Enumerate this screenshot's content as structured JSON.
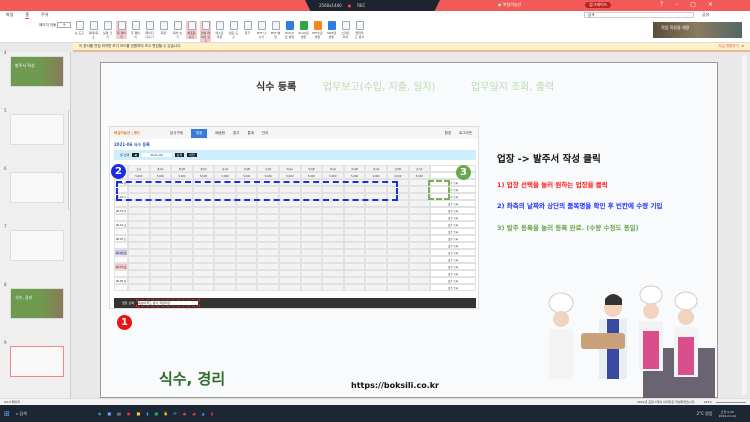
{
  "titlebar": {
    "recording": "REC",
    "screen": "2560x1440",
    "meeting": "미팅중입니다",
    "user": "복실이농산",
    "upgrade": "업그레이드",
    "window_controls": [
      "?",
      "–",
      "□",
      "×"
    ]
  },
  "menu_tabs": [
    "파일",
    "홈",
    "주석"
  ],
  "ribbon": {
    "page_label": "페이지 이동",
    "page_value": "9",
    "search_placeholder": "검색",
    "share": "공유",
    "tools": [
      [
        "손 도구",
        ""
      ],
      [
        "확대/축소",
        ""
      ],
      [
        "실제 크기",
        ""
      ],
      [
        "쪽 페이지",
        "sel"
      ],
      [
        "두 페이지",
        ""
      ],
      [
        "페이지 나누기",
        ""
      ],
      [
        "회전",
        ""
      ],
      [
        "목차 보기",
        ""
      ],
      [
        "발표용 보기",
        "sel"
      ],
      [
        "연속 페이지 보기",
        "sel"
      ],
      [
        "텍스트 작성",
        ""
      ],
      [
        "필요 도구",
        ""
      ],
      [
        "찾기",
        ""
      ],
      [
        "PDF 나누기",
        ""
      ],
      [
        "PDF 병합",
        ""
      ],
      [
        "DOCX로 변환",
        "b"
      ],
      [
        "XLSX로 변환",
        "g"
      ],
      [
        "PPTX로 변환",
        "o"
      ],
      [
        "HWP로 변환",
        "b"
      ],
      [
        "스마트 회의",
        ""
      ],
      [
        "클라우드 문서",
        ""
      ]
    ]
  },
  "ad": {
    "text": "직업 직원들 채용"
  },
  "notice": {
    "message": "이 문서를 편집 하려면 보기 모드를 전환하여 보고 편집할 수 있습니다.",
    "action": "지금 변환하기",
    "close": "×"
  },
  "thumbnails": [
    {
      "num": "4",
      "type": "green",
      "title": "발주서 작성"
    },
    {
      "num": "5",
      "type": "slide"
    },
    {
      "num": "6",
      "type": "slide"
    },
    {
      "num": "7",
      "type": "slide"
    },
    {
      "num": "8",
      "type": "green",
      "title": "식수, 경리"
    },
    {
      "num": "9",
      "type": "slide",
      "selected": true
    },
    {
      "num": "10",
      "type": "slide"
    }
  ],
  "slide": {
    "tabs": [
      {
        "label": "식수 등록",
        "color": "#1f5a1f"
      },
      {
        "label": "업무보고(수입, 지출, 일지)",
        "color": "#b9dbb0"
      },
      {
        "label": "업무일지 조회, 출력",
        "color": "#b9dbb0"
      }
    ],
    "app": {
      "logo": "복실이농산 | 푸드",
      "nav": [
        "본사구매",
        "업장",
        "배송현",
        "창고",
        "통계",
        "관리"
      ],
      "active_nav": 1,
      "right_nav": [
        "환경",
        "로그아웃"
      ],
      "page_title": "2021-06 식수 등록",
      "search_label": "월 선택",
      "search_value": "2021-06",
      "search_btn": "검색",
      "prev_btn": "이전",
      "columns": [
        "",
        "조식",
        "중식A",
        "중식B",
        "중식C",
        "석식A",
        "석식B",
        "석식C",
        "야식A",
        "야식B",
        "특식A",
        "특식B",
        "간식A",
        "간식B",
        "간식C"
      ],
      "prices": [
        "",
        "5,000",
        "5,000",
        "5,000",
        "5,000",
        "5,000",
        "5,000",
        "5,000",
        "5,000",
        "5,000",
        "5,000",
        "5,000",
        "4,000",
        "4,000",
        "5,000"
      ],
      "rows": [
        "06-01 화",
        "06-02 수",
        "06-03 목",
        "06-04 금",
        "06-05 토",
        "06-06 일",
        "06-07 월",
        "06-08 화"
      ],
      "row_button": "발주 등록",
      "footer_label": "업장 선택",
      "footer_value": "복실이푸드 본사 직원식당"
    },
    "callouts": {
      "one": "1",
      "two": "2",
      "three": "3"
    },
    "heading": "업장 -> 발주서 작성 클릭",
    "steps": [
      {
        "text": "1) 업장 선택을 눌러 원하는 업장을 클릭",
        "color": "#ff2020"
      },
      {
        "text": "2) 좌측의 날짜와 상단의 품목명을 확인 후 빈칸에 수량 기입",
        "color": "#2030ff"
      },
      {
        "text": "3) 발주 등록을 눌러 등록 완료. (수량 수정도 동일)",
        "color": "#6aa84f"
      }
    ],
    "footer_title": "식수, 경리",
    "url": "https://boksili.co.kr"
  },
  "statusbar": {
    "left": "9/10 페이지",
    "right": "2021년 포함 4개의 이미지로 작성되었습니다.",
    "zoom": "164%"
  },
  "taskbar": {
    "search": "검색",
    "weather": "2°C 맑음",
    "time": "오전 9:20",
    "date": "2024-01-04"
  }
}
